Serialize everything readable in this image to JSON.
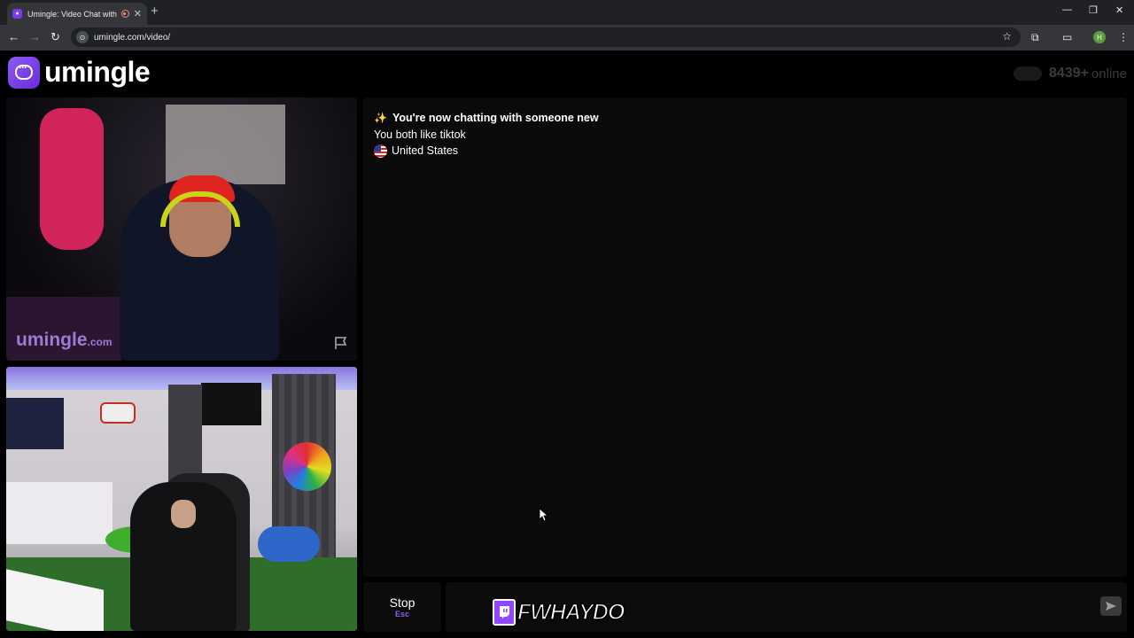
{
  "browser": {
    "tab_title": "Umingle: Video Chat with S",
    "tab_close": "✕",
    "new_tab": "+",
    "url": "umingle.com/video/",
    "window_controls": {
      "minimize": "—",
      "maximize": "❐",
      "close": "✕"
    }
  },
  "header": {
    "logo_text": "umingle",
    "online_count": "8439+",
    "online_label": "online"
  },
  "stranger_video": {
    "watermark_main": "umingle",
    "watermark_suffix": ".com"
  },
  "chat": {
    "messages": [
      {
        "icon": "sparkles-icon",
        "text": "You're now chatting with someone new"
      },
      {
        "text": "You both like tiktok"
      },
      {
        "icon": "us-flag-icon",
        "text": "United States"
      }
    ]
  },
  "controls": {
    "stop_label": "Stop",
    "stop_key": "Esc",
    "message_value": ""
  },
  "stream_overlay": {
    "name": "FWHAYDO"
  },
  "colors": {
    "brand": "#7c3aed",
    "accent_key": "#8b5cf6",
    "background": "#000000"
  }
}
